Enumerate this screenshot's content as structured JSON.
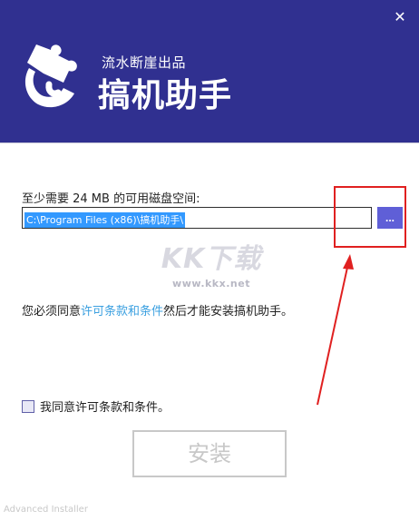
{
  "header": {
    "subtitle": "流水断崖出品",
    "title": "搞机助手",
    "close_glyph": "✕",
    "background_color": "#303090"
  },
  "install": {
    "space_label": "至少需要 24 MB 的可用磁盘空间:",
    "path_value": "C:\\Program Files (x86)\\搞机助手\\",
    "browse_label": "...",
    "browse_color": "#5f5fd7",
    "terms_before": "您必须同意",
    "terms_link": "许可条款和条件",
    "terms_after": "然后才能安装搞机助手。",
    "link_color": "#3ba0e0",
    "agree_label": "我同意许可条款和条件。",
    "agree_checked": false,
    "install_button": "安装",
    "install_enabled": false
  },
  "watermark": {
    "logo": "KK下载",
    "url": "www.kkx.net"
  },
  "footer": {
    "text": "Advanced Installer"
  },
  "annotation": {
    "color": "#e02020",
    "shapes": [
      "highlight-box",
      "arrow"
    ]
  }
}
